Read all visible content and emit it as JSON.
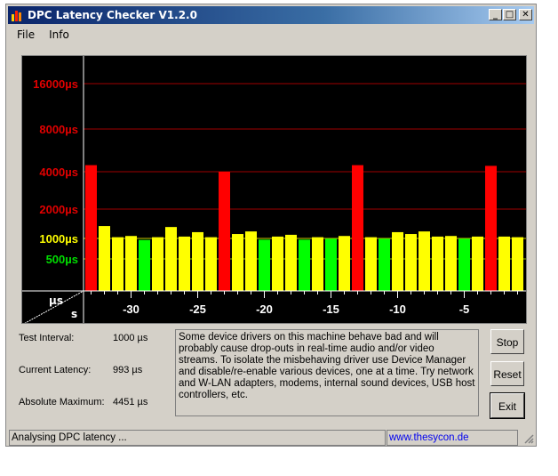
{
  "window": {
    "title": "DPC Latency Checker V1.2.0",
    "minimize": "_",
    "maximize": "□",
    "close": "✕"
  },
  "menu": [
    "File",
    "Info"
  ],
  "chart_data": {
    "type": "bar",
    "y_scale": "log2",
    "y_ticks": [
      {
        "label": "16000µs",
        "value": 16000,
        "color": "#e00000"
      },
      {
        "label": "8000µs",
        "value": 8000,
        "color": "#e00000"
      },
      {
        "label": "4000µs",
        "value": 4000,
        "color": "#e00000"
      },
      {
        "label": "2000µs",
        "value": 2000,
        "color": "#e00000"
      },
      {
        "label": "1000µs",
        "value": 1000,
        "color": "#ffff00"
      },
      {
        "label": "500µs",
        "value": 500,
        "color": "#00dd00"
      }
    ],
    "x_ticks": [
      -30,
      -25,
      -20,
      -15,
      -10,
      -5
    ],
    "corner": {
      "y_unit": "µs",
      "x_unit": "s"
    },
    "x": [
      -33,
      -32,
      -31,
      -30,
      -29,
      -28,
      -27,
      -26,
      -25,
      -24,
      -23,
      -22,
      -21,
      -20,
      -19,
      -18,
      -17,
      -16,
      -15,
      -14,
      -13,
      -12,
      -11,
      -10,
      -9,
      -8,
      -7,
      -6,
      -5,
      -4,
      -3,
      -2,
      -1
    ],
    "values": [
      4450,
      1340,
      1030,
      1060,
      950,
      1030,
      1310,
      1045,
      1160,
      1030,
      4000,
      1110,
      1180,
      960,
      1045,
      1090,
      960,
      1030,
      990,
      1060,
      4450,
      1030,
      990,
      1160,
      1110,
      1180,
      1045,
      1060,
      990,
      1045,
      4400,
      1045,
      1030
    ],
    "colors": [
      "r",
      "y",
      "y",
      "y",
      "g",
      "y",
      "y",
      "y",
      "y",
      "y",
      "r",
      "y",
      "y",
      "g",
      "y",
      "y",
      "g",
      "y",
      "g",
      "y",
      "r",
      "y",
      "g",
      "y",
      "y",
      "y",
      "y",
      "y",
      "g",
      "y",
      "r",
      "y",
      "y"
    ],
    "palette": {
      "r": "#ff0000",
      "y": "#ffff00",
      "g": "#00ff00"
    }
  },
  "stats": {
    "interval_label": "Test Interval:",
    "interval_value": "1000 µs",
    "current_label": "Current Latency:",
    "current_value": "993 µs",
    "max_label": "Absolute Maximum:",
    "max_value": "4451 µs"
  },
  "message": "Some device drivers on this machine behave bad and will probably cause drop-outs in real-time audio and/or video streams. To isolate the misbehaving driver use Device Manager and disable/re-enable various devices, one at a time. Try network and W-LAN adapters, modems, internal sound devices, USB host controllers, etc.",
  "buttons": {
    "stop": "Stop",
    "reset": "Reset",
    "exit": "Exit"
  },
  "status": {
    "text": "Analysing DPC latency ...",
    "link": "www.thesycon.de"
  }
}
